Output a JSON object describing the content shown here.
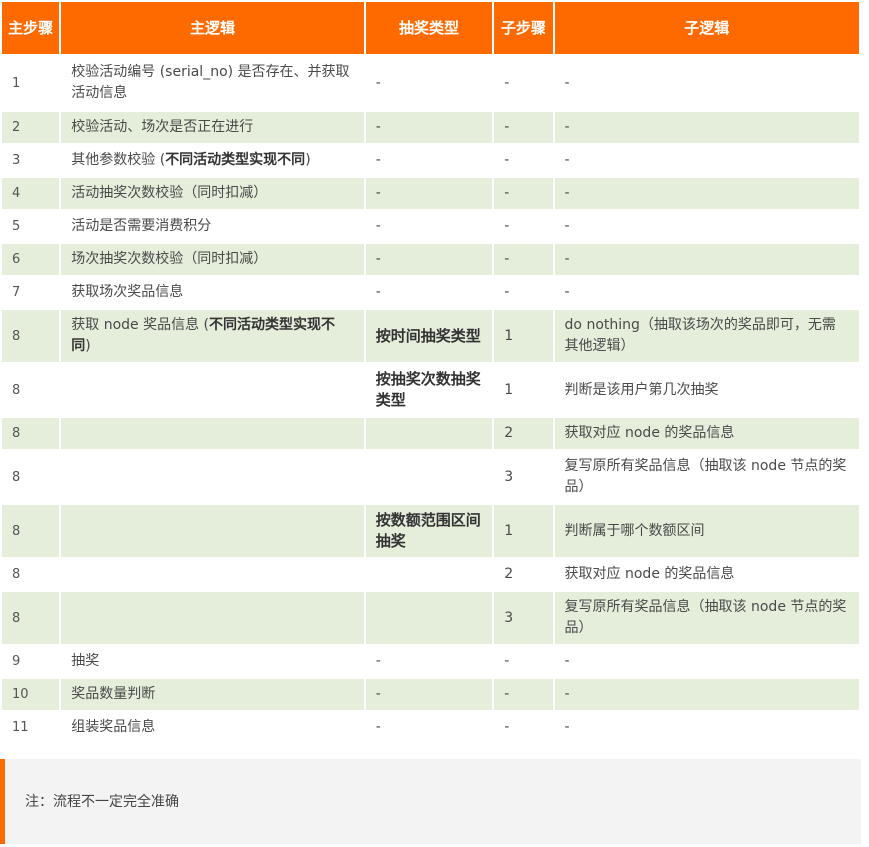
{
  "header": {
    "step": "主步骤",
    "logic": "主逻辑",
    "lottery_type": "抽奖类型",
    "substep": "子步骤",
    "sublogic": "子逻辑"
  },
  "rows": [
    {
      "step": "1",
      "logic": "校验活动编号 (serial_no) 是否存在、并获取活动信息",
      "type": "-",
      "substep": "-",
      "sublogic": "-"
    },
    {
      "step": "2",
      "logic": "校验活动、场次是否正在进行",
      "type": "-",
      "substep": "-",
      "sublogic": "-"
    },
    {
      "step": "3",
      "logic_pre": "其他参数校验 (",
      "logic_bold": "不同活动类型实现不同",
      "logic_post": ")",
      "type": "-",
      "substep": "-",
      "sublogic": "-"
    },
    {
      "step": "4",
      "logic": "活动抽奖次数校验（同时扣减）",
      "type": "-",
      "substep": "-",
      "sublogic": "-"
    },
    {
      "step": "5",
      "logic": "活动是否需要消费积分",
      "type": "-",
      "substep": "-",
      "sublogic": "-"
    },
    {
      "step": "6",
      "logic": "场次抽奖次数校验（同时扣减）",
      "type": "-",
      "substep": "-",
      "sublogic": "-"
    },
    {
      "step": "7",
      "logic": "获取场次奖品信息",
      "type": "-",
      "substep": "-",
      "sublogic": "-"
    },
    {
      "step": "8",
      "logic_pre": "获取 node 奖品信息 (",
      "logic_bold": "不同活动类型实现不同",
      "logic_post": ")",
      "type": "按时间抽奖类型",
      "substep": "1",
      "sublogic": "do nothing（抽取该场次的奖品即可，无需其他逻辑）"
    },
    {
      "step": "8",
      "logic": "",
      "type": "按抽奖次数抽奖类型",
      "substep": "1",
      "sublogic": "判断是该用户第几次抽奖"
    },
    {
      "step": "8",
      "logic": "",
      "type": "",
      "substep": "2",
      "sublogic": "获取对应 node 的奖品信息"
    },
    {
      "step": "8",
      "logic": "",
      "type": "",
      "substep": "3",
      "sublogic": "复写原所有奖品信息（抽取该 node 节点的奖品）"
    },
    {
      "step": "8",
      "logic": "",
      "type": "按数额范围区间抽奖",
      "substep": "1",
      "sublogic": "判断属于哪个数额区间"
    },
    {
      "step": "8",
      "logic": "",
      "type": "",
      "substep": "2",
      "sublogic": "获取对应 node 的奖品信息"
    },
    {
      "step": "8",
      "logic": "",
      "type": "",
      "substep": "3",
      "sublogic": "复写原所有奖品信息（抽取该 node 节点的奖品）"
    },
    {
      "step": "9",
      "logic": "抽奖",
      "type": "-",
      "substep": "-",
      "sublogic": "-"
    },
    {
      "step": "10",
      "logic": "奖品数量判断",
      "type": "-",
      "substep": "-",
      "sublogic": "-"
    },
    {
      "step": "11",
      "logic": "组装奖品信息",
      "type": "-",
      "substep": "-",
      "sublogic": "-"
    }
  ],
  "note": "注：流程不一定完全准确",
  "colors": {
    "header_bg": "#ff6a00",
    "alt_row_bg": "#e4eedb",
    "note_bg": "#f3f3f3",
    "note_bar": "#ff6a00"
  }
}
